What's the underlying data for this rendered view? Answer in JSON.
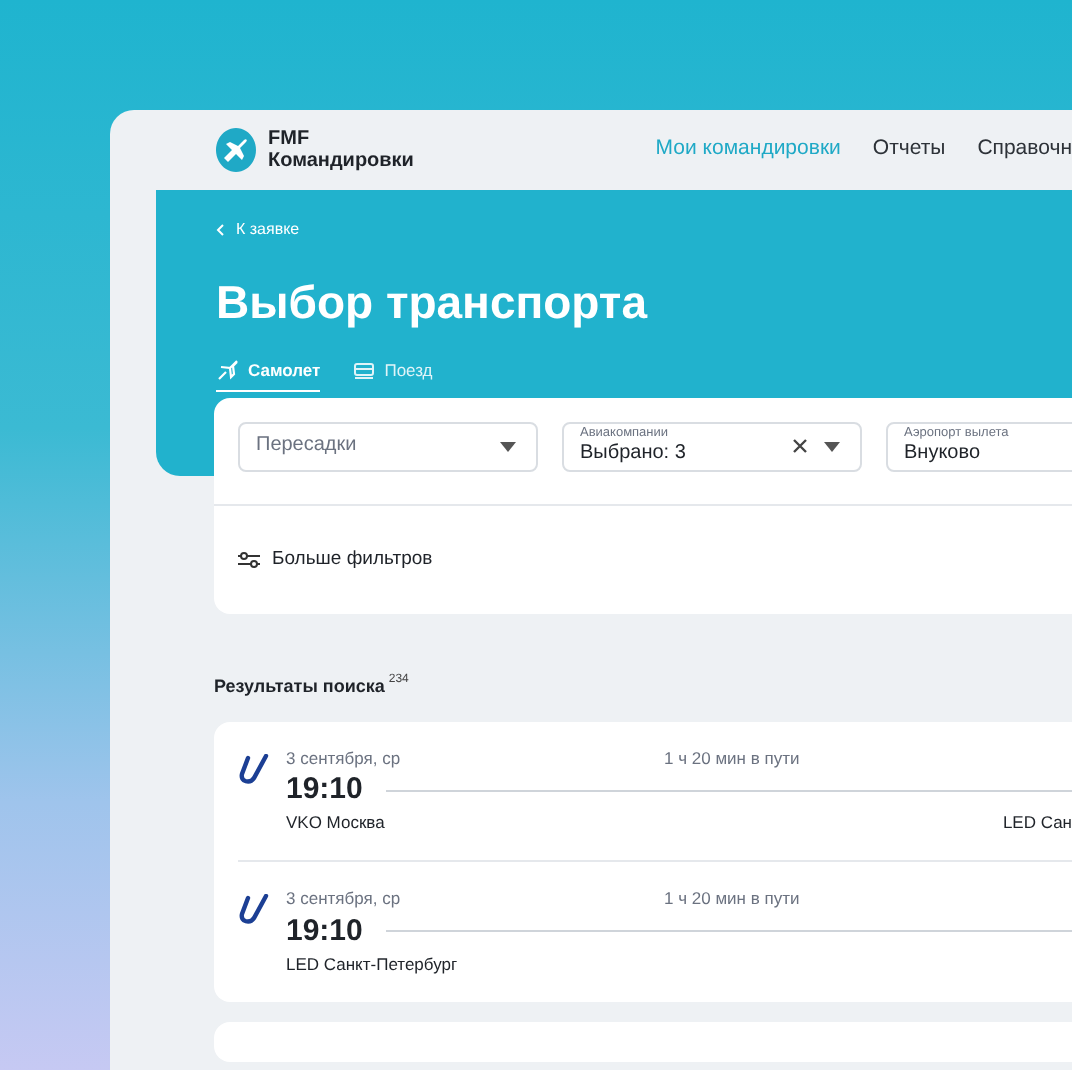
{
  "brand": {
    "line1": "FMF",
    "line2": "Командировки"
  },
  "nav": [
    {
      "label": "Мои командировки",
      "selected": true
    },
    {
      "label": "Отчеты",
      "selected": false
    },
    {
      "label": "Справочн",
      "selected": false
    }
  ],
  "back_link": "К заявке",
  "title": "Выбор транспорта",
  "tabs": [
    {
      "label": "Самолет",
      "kind": "plane",
      "selected": true
    },
    {
      "label": "Поезд",
      "kind": "train",
      "selected": false
    }
  ],
  "filters": [
    {
      "placeholder": "Пересадки",
      "clearable": false
    },
    {
      "label": "Авиакомпании",
      "value": "Выбрано: 3",
      "clearable": true
    },
    {
      "label": "Аэропорт вылета",
      "value": "Внуково"
    }
  ],
  "more_filters": "Больше фильтров",
  "results": {
    "label": "Результаты поиска",
    "count": "234"
  },
  "flights": [
    {
      "date": "3 сентября, ср",
      "time": "19:10",
      "duration": "1 ч 20 мин в пути",
      "from": "VKO Москва",
      "to": "LED Сан"
    },
    {
      "date": "3 сентября, ср",
      "time": "19:10",
      "duration": "1 ч 20 мин в пути",
      "from": "LED Санкт-Петербург"
    }
  ]
}
